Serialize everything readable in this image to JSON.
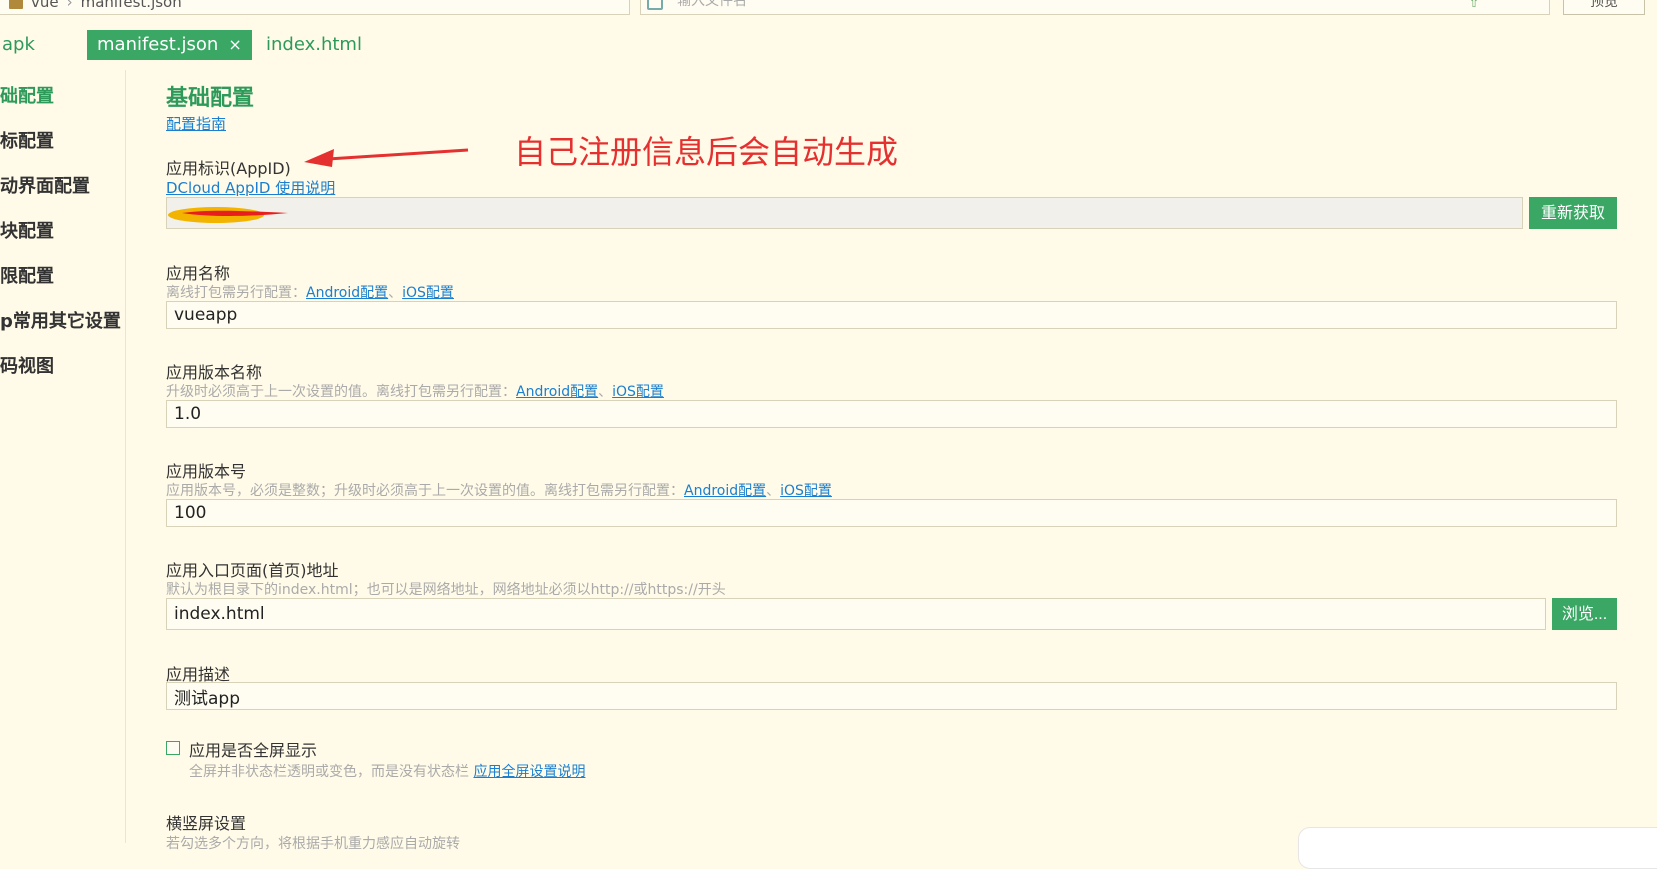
{
  "breadcrumb": {
    "folder": "vue",
    "file": "manifest.json"
  },
  "search": {
    "placeholder": "输入文件名"
  },
  "preview_button": "预览",
  "tabs": [
    {
      "label": "apk",
      "active": false
    },
    {
      "label": "manifest.json",
      "active": true,
      "close": "×"
    },
    {
      "label": "index.html",
      "active": false
    }
  ],
  "sidebar": {
    "items": [
      {
        "label": "础配置",
        "active": true
      },
      {
        "label": "标配置",
        "active": false
      },
      {
        "label": "动界面配置",
        "active": false
      },
      {
        "label": "块配置",
        "active": false
      },
      {
        "label": "限配置",
        "active": false
      },
      {
        "label": "p常用其它设置",
        "active": false
      },
      {
        "label": "码视图",
        "active": false
      }
    ]
  },
  "content": {
    "title": "基础配置",
    "guide_link": "配置指南",
    "appid": {
      "label": "应用标识(AppID)",
      "help_link": "DCloud AppID 使用说明",
      "button": "重新获取"
    },
    "annotation": "自己注册信息后会自动生成",
    "app_name": {
      "label": "应用名称",
      "hint": "离线打包需另行配置：",
      "android_link": "Android配置",
      "sep": "、",
      "ios_link": "iOS配置",
      "value": "vueapp"
    },
    "version_name": {
      "label": "应用版本名称",
      "hint": "升级时必须高于上一次设置的值。离线打包需另行配置：",
      "android_link": "Android配置",
      "sep": "、",
      "ios_link": "iOS配置",
      "value": "1.0"
    },
    "version_code": {
      "label": "应用版本号",
      "hint": "应用版本号，必须是整数；升级时必须高于上一次设置的值。离线打包需另行配置：",
      "android_link": "Android配置",
      "sep": "、",
      "ios_link": "iOS配置",
      "value": "100"
    },
    "entry_page": {
      "label": "应用入口页面(首页)地址",
      "hint": "默认为根目录下的index.html；也可以是网络地址，网络地址必须以http://或https://开头",
      "value": "index.html",
      "button": "浏览..."
    },
    "description": {
      "label": "应用描述",
      "value": "测试app"
    },
    "fullscreen": {
      "label": "应用是否全屏显示",
      "hint": "全屏并非状态栏透明或变色，而是没有状态栏",
      "link": "应用全屏设置说明",
      "checked": false
    },
    "orientation": {
      "label": "横竖屏设置",
      "hint": "若勾选多个方向，将根据手机重力感应自动旋转"
    }
  },
  "colors": {
    "accent": "#3aa764",
    "link": "#1a7fd0",
    "annotation": "#e53030",
    "background": "#fffbe8"
  }
}
